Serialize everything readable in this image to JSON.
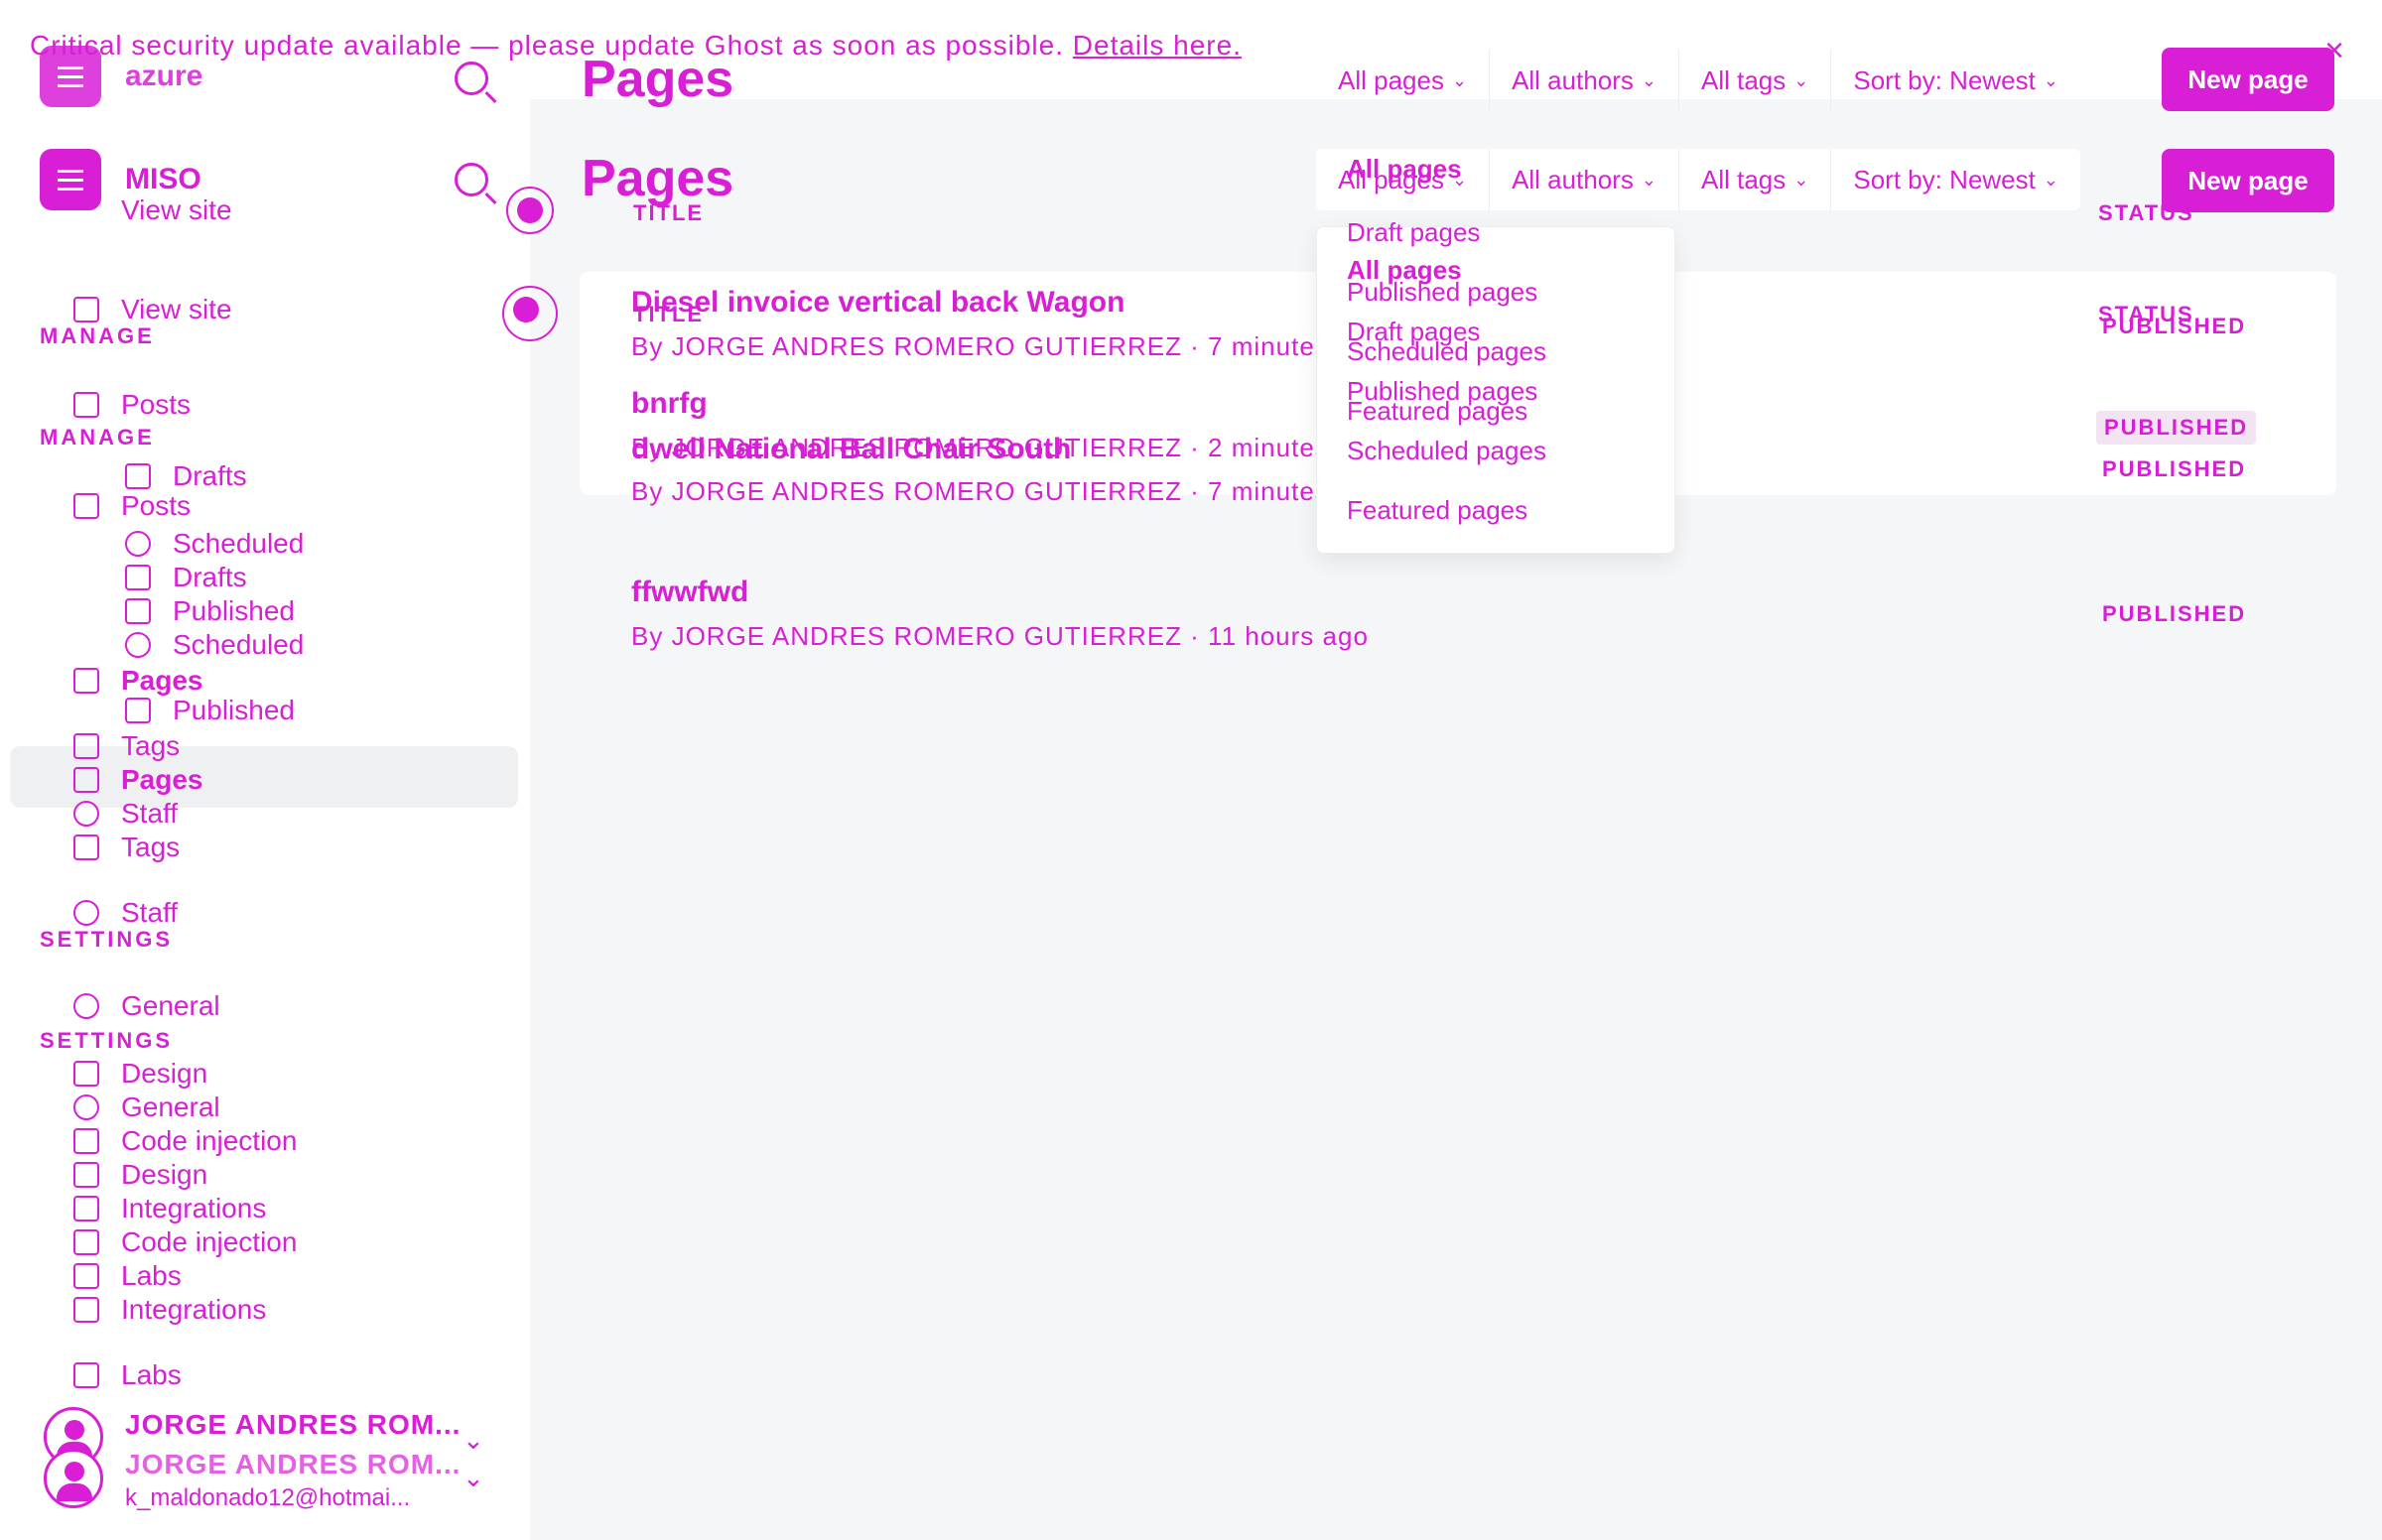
{
  "banner": {
    "text": "Critical security update available — please update Ghost as soon as possible.",
    "link": "Details here.",
    "close": "×"
  },
  "sidebar": {
    "brand_top": "azure",
    "brand": "MISO",
    "view_site": "View site",
    "manage_heading": "MANAGE",
    "settings_heading": "SETTINGS",
    "posts": "Posts",
    "drafts": "Drafts",
    "scheduled": "Scheduled",
    "published": "Published",
    "pages": "Pages",
    "tags": "Tags",
    "staff": "Staff",
    "general": "General",
    "design": "Design",
    "code_injection": "Code injection",
    "integrations": "Integrations",
    "labs": "Labs"
  },
  "user": {
    "name": "JORGE ANDRES ROM...",
    "email": "k_maldonado12@hotmai..."
  },
  "main": {
    "title": "Pages",
    "new_page": "New page",
    "filters": {
      "type": "All pages",
      "authors": "All authors",
      "tags": "All tags",
      "sort": "Sort by: Newest"
    },
    "columns": {
      "title": "TITLE",
      "status": "STATUS"
    },
    "rows": [
      {
        "title": "Diesel invoice vertical back Wagon",
        "meta": "By JORGE ANDRES ROMERO GUTIERREZ · 7 minutes ago",
        "status": "PUBLISHED"
      },
      {
        "title": "bnrfg",
        "meta": "By JORGE ANDRES ROMERO GUTIERREZ · 2 minutes ago",
        "status": "PUBLISHED"
      },
      {
        "title": "dwell National Ball Chair South",
        "meta": "By JORGE ANDRES ROMERO GUTIERREZ · 7 minutes ago",
        "status": "PUBLISHED"
      },
      {
        "title": "ffwwfwd",
        "meta": "By JORGE ANDRES ROMERO GUTIERREZ · 11 hours ago",
        "status": "PUBLISHED"
      }
    ]
  },
  "dropdown": {
    "options": [
      "All pages",
      "Draft pages",
      "Published pages",
      "Scheduled pages",
      "Featured pages"
    ]
  },
  "colors": {
    "accent": "#d81fd6",
    "main_bg": "#f4f6f8"
  }
}
